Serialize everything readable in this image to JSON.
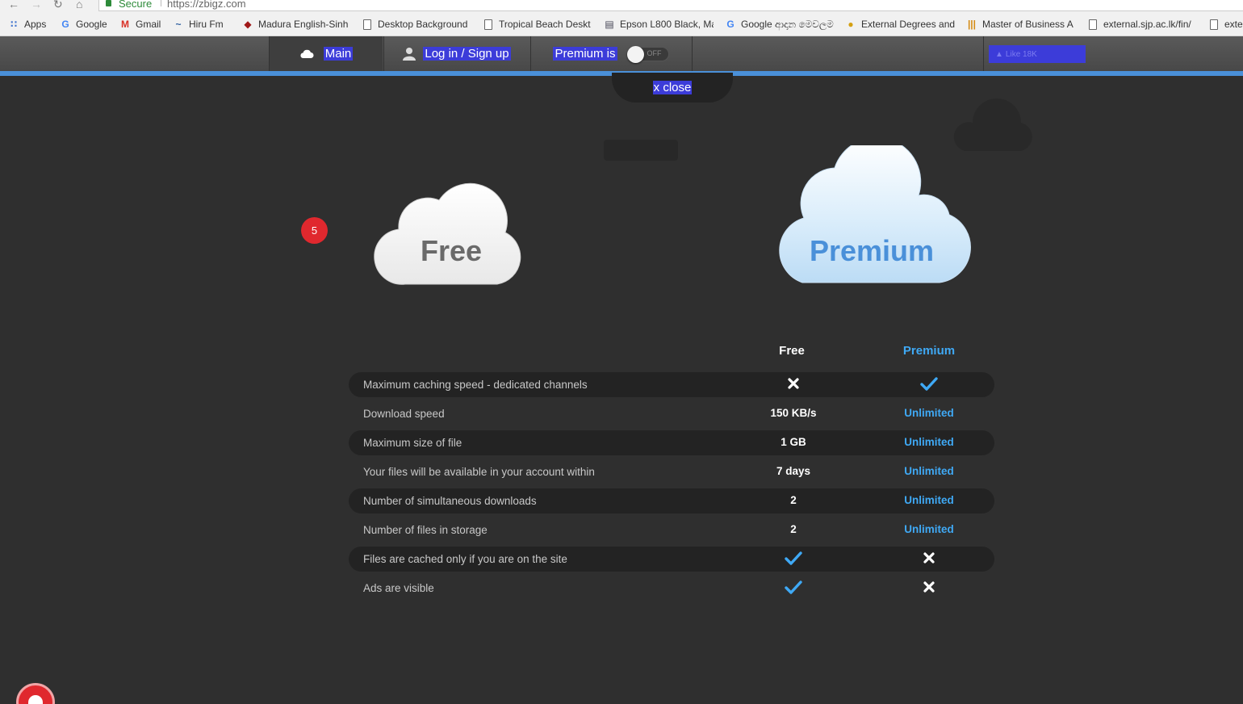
{
  "browser": {
    "secure_label": "Secure",
    "url": "https://zbigz.com"
  },
  "bookmarks": [
    {
      "label": "Apps",
      "icon": "apps-grid-icon"
    },
    {
      "label": "Google",
      "icon": "google-icon"
    },
    {
      "label": "Gmail",
      "icon": "gmail-icon"
    },
    {
      "label": "Hiru Fm",
      "icon": "radio-icon"
    },
    {
      "label": "Madura English-Sinh",
      "icon": "madura-icon"
    },
    {
      "label": "Desktop Background",
      "icon": "page-icon"
    },
    {
      "label": "Tropical Beach Deskt",
      "icon": "page-icon"
    },
    {
      "label": "Epson L800 Black, Ma",
      "icon": "printer-icon"
    },
    {
      "label": "Google ආදාන මෙවලම",
      "icon": "google-icon"
    },
    {
      "label": "External Degrees and",
      "icon": "circle-icon"
    },
    {
      "label": "Master of Business A",
      "icon": "bars-icon"
    },
    {
      "label": "external.sjp.ac.lk/fin/",
      "icon": "page-icon"
    },
    {
      "label": "exte",
      "icon": "page-icon"
    }
  ],
  "topbar": {
    "main_label": "Main",
    "login_label": "Log in / Sign up",
    "premium_label": "Premium is",
    "toggle_state": "OFF",
    "like_label": "Like 18K",
    "close_label": "x close"
  },
  "badge_count": "5",
  "plans": {
    "free_cloud": "Free",
    "premium_cloud": "Premium"
  },
  "table": {
    "col_free": "Free",
    "col_premium": "Premium",
    "rows": [
      {
        "feature": "Maximum caching speed - dedicated channels",
        "free": "cross",
        "premium": "check"
      },
      {
        "feature": "Download speed",
        "free": "150 KB/s",
        "premium": "Unlimited"
      },
      {
        "feature": "Maximum size of file",
        "free": "1 GB",
        "premium": "Unlimited"
      },
      {
        "feature": "Your files will be available in your account within",
        "free": "7 days",
        "premium": "Unlimited"
      },
      {
        "feature": "Number of simultaneous downloads",
        "free": "2",
        "premium": "Unlimited"
      },
      {
        "feature": "Number of files in storage",
        "free": "2",
        "premium": "Unlimited"
      },
      {
        "feature": "Files are cached only if you are on the site",
        "free": "check",
        "premium": "cross"
      },
      {
        "feature": "Ads are visible",
        "free": "check",
        "premium": "cross"
      }
    ]
  },
  "colors": {
    "accent_blue": "#3fa9f5",
    "selection_blue": "#3c3cd9",
    "badge_red": "#e0282e",
    "top_line": "#4a90d9"
  }
}
